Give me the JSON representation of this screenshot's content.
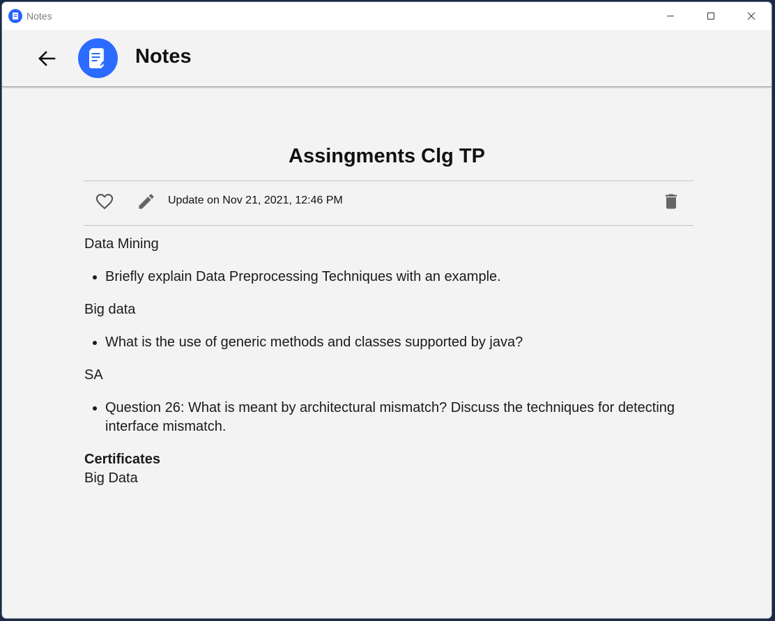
{
  "window": {
    "title": "Notes"
  },
  "appbar": {
    "title": "Notes",
    "back_icon": "arrow-left-icon",
    "logo_icon": "note-edit-icon",
    "accent_color": "#2b6bff"
  },
  "note": {
    "title": "Assingments Clg TP",
    "updated": "Update on Nov 21, 2021, 12:46 PM",
    "favorite_icon": "heart-outline-icon",
    "edit_icon": "pencil-icon",
    "delete_icon": "trash-icon",
    "sections": [
      {
        "heading": "Data Mining",
        "items": [
          "Briefly explain Data Preprocessing Techniques with an example."
        ]
      },
      {
        "heading": "Big data",
        "items": [
          "What is the use of generic methods and classes supported by java?"
        ]
      },
      {
        "heading": "SA",
        "items": [
          "Question 26: What is meant by architectural mismatch? Discuss the techniques for detecting interface mismatch."
        ]
      }
    ],
    "certificates_heading": "Certificates",
    "certificates_body": "Big Data"
  }
}
